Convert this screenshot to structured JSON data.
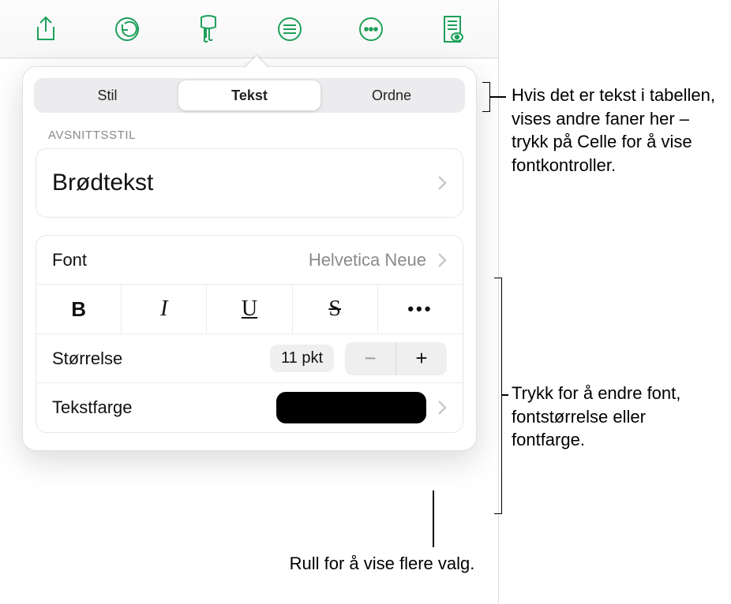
{
  "tabs": {
    "stil": "Stil",
    "tekst": "Tekst",
    "ordne": "Ordne"
  },
  "section": {
    "avsnittsstil": "AVSNITTSSTIL"
  },
  "paragraph_style": {
    "current": "Brødtekst"
  },
  "font_row": {
    "label": "Font",
    "value": "Helvetica Neue"
  },
  "size_row": {
    "label": "Størrelse",
    "value": "11 pkt"
  },
  "color_row": {
    "label": "Tekstfarge",
    "swatch": "#000000"
  },
  "style_buttons": {
    "bold": "B",
    "italic": "I",
    "underline": "U",
    "strike": "S",
    "more": "•••"
  },
  "callouts": {
    "tabs_hint": "Hvis det er tekst i tabellen, vises andre faner her – trykk på Celle for å vise fontkontroller.",
    "font_hint": "Trykk for å endre font, fontstørrelse eller fontfarge.",
    "scroll_hint": "Rull for å vise flere valg."
  }
}
